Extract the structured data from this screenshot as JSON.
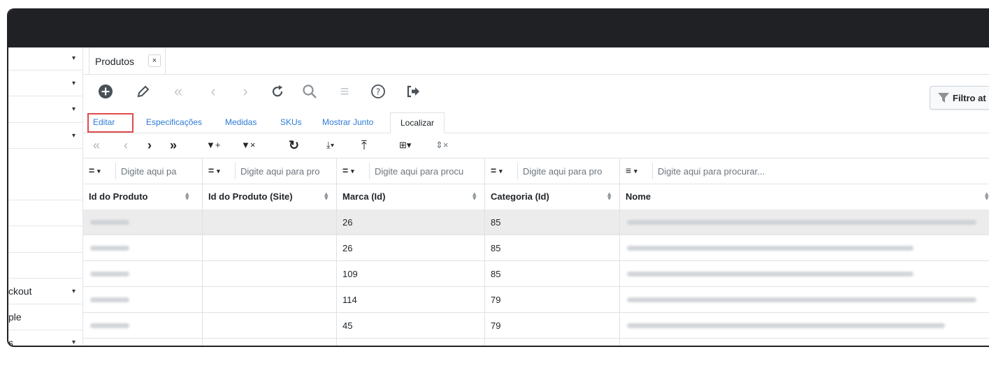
{
  "sidebar": {
    "items": [
      {
        "label": "",
        "caret": true
      },
      {
        "label": "",
        "caret": true
      },
      {
        "label": "",
        "caret": true
      },
      {
        "label": "",
        "caret": true
      },
      {
        "label": "",
        "caret": false
      },
      {
        "label": "",
        "caret": false
      },
      {
        "label": "",
        "caret": false
      },
      {
        "label": "ckout",
        "caret": true
      },
      {
        "label": "ple",
        "caret": false
      },
      {
        "label": "s",
        "caret": true
      }
    ]
  },
  "doc_tab": {
    "label": "Produtos",
    "close": "×"
  },
  "filter_button": {
    "label": "Filtro at"
  },
  "subtabs": {
    "editar": "Editar",
    "especificacoes": "Especificações",
    "medidas": "Medidas",
    "skus": "SKUs",
    "mostrar_junto": "Mostrar Junto",
    "localizar": "Localizar"
  },
  "grid_toolbar": {
    "first": "«",
    "prev": "‹",
    "next": "›",
    "last": "»",
    "add_filter": "▼+",
    "clear_filter": "▼×",
    "refresh": "↻",
    "export": "⤓▾",
    "import": "⤒",
    "columns": "⊞▾",
    "clear_sort": "⇕×"
  },
  "filters": [
    {
      "op": "=",
      "placeholder": "Digite aqui pa"
    },
    {
      "op": "=",
      "placeholder": "Digite aqui para pro"
    },
    {
      "op": "=",
      "placeholder": "Digite aqui para procu"
    },
    {
      "op": "=",
      "placeholder": "Digite aqui para pro"
    },
    {
      "op": "≡",
      "placeholder": "Digite aqui para procurar..."
    }
  ],
  "columns": [
    "Id do Produto",
    "Id do Produto (Site)",
    "Marca (Id)",
    "Categoria (Id)",
    "Nome"
  ],
  "rows": [
    {
      "marca": "26",
      "categoria": "85",
      "selected": true
    },
    {
      "marca": "26",
      "categoria": "85",
      "selected": false
    },
    {
      "marca": "109",
      "categoria": "85",
      "selected": false
    },
    {
      "marca": "114",
      "categoria": "79",
      "selected": false
    },
    {
      "marca": "45",
      "categoria": "79",
      "selected": false
    }
  ],
  "colors": {
    "highlight": "#e04b4b",
    "link": "#2d7bd6",
    "topbar": "#1f2124"
  }
}
